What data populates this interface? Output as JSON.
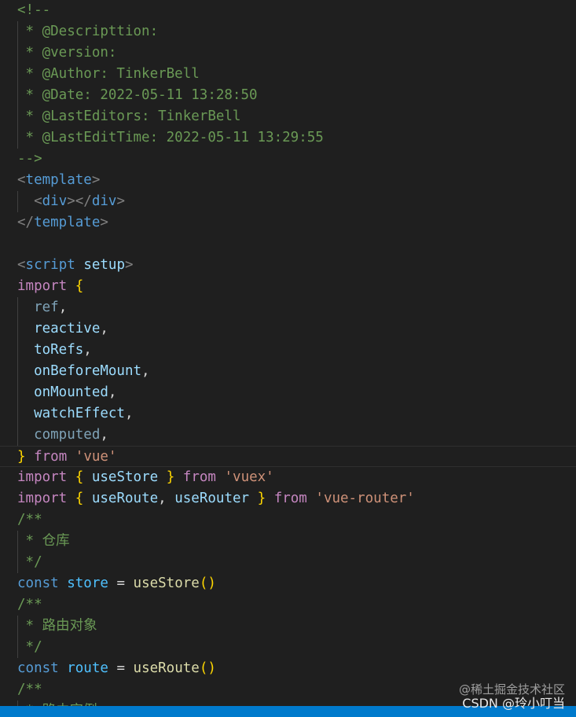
{
  "editor": {
    "lines": [
      {
        "indent": 0,
        "tokens": [
          [
            "c-comment",
            "<!--"
          ]
        ]
      },
      {
        "indent": 0,
        "guide": true,
        "tokens": [
          [
            "c-comment",
            " * @Descripttion:"
          ]
        ]
      },
      {
        "indent": 0,
        "guide": true,
        "tokens": [
          [
            "c-comment",
            " * @version:"
          ]
        ]
      },
      {
        "indent": 0,
        "guide": true,
        "tokens": [
          [
            "c-comment",
            " * @Author: TinkerBell"
          ]
        ]
      },
      {
        "indent": 0,
        "guide": true,
        "tokens": [
          [
            "c-comment",
            " * @Date: 2022-05-11 13:28:50"
          ]
        ]
      },
      {
        "indent": 0,
        "guide": true,
        "tokens": [
          [
            "c-comment",
            " * @LastEditors: TinkerBell"
          ]
        ]
      },
      {
        "indent": 0,
        "guide": true,
        "tokens": [
          [
            "c-comment",
            " * @LastEditTime: 2022-05-11 13:29:55"
          ]
        ]
      },
      {
        "indent": 0,
        "tokens": [
          [
            "c-comment",
            "-->"
          ]
        ]
      },
      {
        "indent": 0,
        "tokens": [
          [
            "c-tag-punct",
            "<"
          ],
          [
            "c-tag",
            "template"
          ],
          [
            "c-tag-punct",
            ">"
          ]
        ]
      },
      {
        "indent": 0,
        "guide": true,
        "tokens": [
          [
            "c-plain",
            "  "
          ],
          [
            "c-tag-punct",
            "<"
          ],
          [
            "c-tag",
            "div"
          ],
          [
            "c-tag-punct",
            "></"
          ],
          [
            "c-tag",
            "div"
          ],
          [
            "c-tag-punct",
            ">"
          ]
        ]
      },
      {
        "indent": 0,
        "tokens": [
          [
            "c-tag-punct",
            "</"
          ],
          [
            "c-tag",
            "template"
          ],
          [
            "c-tag-punct",
            ">"
          ]
        ]
      },
      {
        "indent": 0,
        "tokens": [
          [
            "c-plain",
            ""
          ]
        ]
      },
      {
        "indent": 0,
        "tokens": [
          [
            "c-tag-punct",
            "<"
          ],
          [
            "c-tag",
            "script"
          ],
          [
            "c-plain",
            " "
          ],
          [
            "c-attr",
            "setup"
          ],
          [
            "c-tag-punct",
            ">"
          ]
        ]
      },
      {
        "indent": 0,
        "tokens": [
          [
            "c-keyword",
            "import"
          ],
          [
            "c-plain",
            " "
          ],
          [
            "c-brace",
            "{"
          ]
        ]
      },
      {
        "indent": 0,
        "guide": true,
        "tokens": [
          [
            "c-plain",
            "  "
          ],
          [
            "c-var-faint",
            "ref"
          ],
          [
            "c-plain",
            ","
          ]
        ]
      },
      {
        "indent": 0,
        "guide": true,
        "tokens": [
          [
            "c-plain",
            "  "
          ],
          [
            "c-var",
            "reactive"
          ],
          [
            "c-plain",
            ","
          ]
        ]
      },
      {
        "indent": 0,
        "guide": true,
        "tokens": [
          [
            "c-plain",
            "  "
          ],
          [
            "c-var",
            "toRefs"
          ],
          [
            "c-plain",
            ","
          ]
        ]
      },
      {
        "indent": 0,
        "guide": true,
        "tokens": [
          [
            "c-plain",
            "  "
          ],
          [
            "c-var",
            "onBeforeMount"
          ],
          [
            "c-plain",
            ","
          ]
        ]
      },
      {
        "indent": 0,
        "guide": true,
        "tokens": [
          [
            "c-plain",
            "  "
          ],
          [
            "c-var",
            "onMounted"
          ],
          [
            "c-plain",
            ","
          ]
        ]
      },
      {
        "indent": 0,
        "guide": true,
        "tokens": [
          [
            "c-plain",
            "  "
          ],
          [
            "c-var",
            "watchEffect"
          ],
          [
            "c-plain",
            ","
          ]
        ]
      },
      {
        "indent": 0,
        "guide": true,
        "tokens": [
          [
            "c-plain",
            "  "
          ],
          [
            "c-var-faint",
            "computed"
          ],
          [
            "c-plain",
            ","
          ]
        ]
      },
      {
        "indent": 0,
        "current": true,
        "tokens": [
          [
            "c-brace",
            "}"
          ],
          [
            "c-plain",
            " "
          ],
          [
            "c-keyword",
            "from"
          ],
          [
            "c-plain",
            " "
          ],
          [
            "c-string",
            "'vue'"
          ]
        ]
      },
      {
        "indent": 0,
        "tokens": [
          [
            "c-keyword",
            "import"
          ],
          [
            "c-plain",
            " "
          ],
          [
            "c-brace",
            "{"
          ],
          [
            "c-plain",
            " "
          ],
          [
            "c-var",
            "useStore"
          ],
          [
            "c-plain",
            " "
          ],
          [
            "c-brace",
            "}"
          ],
          [
            "c-plain",
            " "
          ],
          [
            "c-keyword",
            "from"
          ],
          [
            "c-plain",
            " "
          ],
          [
            "c-string",
            "'vuex'"
          ]
        ]
      },
      {
        "indent": 0,
        "tokens": [
          [
            "c-keyword",
            "import"
          ],
          [
            "c-plain",
            " "
          ],
          [
            "c-brace",
            "{"
          ],
          [
            "c-plain",
            " "
          ],
          [
            "c-var",
            "useRoute"
          ],
          [
            "c-plain",
            ", "
          ],
          [
            "c-var",
            "useRouter"
          ],
          [
            "c-plain",
            " "
          ],
          [
            "c-brace",
            "}"
          ],
          [
            "c-plain",
            " "
          ],
          [
            "c-keyword",
            "from"
          ],
          [
            "c-plain",
            " "
          ],
          [
            "c-string",
            "'vue-router'"
          ]
        ]
      },
      {
        "indent": 0,
        "tokens": [
          [
            "c-comment",
            "/**"
          ]
        ]
      },
      {
        "indent": 0,
        "guide": true,
        "tokens": [
          [
            "c-comment",
            " * 仓库"
          ]
        ]
      },
      {
        "indent": 0,
        "guide": true,
        "tokens": [
          [
            "c-comment",
            " */"
          ]
        ]
      },
      {
        "indent": 0,
        "tokens": [
          [
            "c-storage",
            "const"
          ],
          [
            "c-plain",
            " "
          ],
          [
            "c-const",
            "store"
          ],
          [
            "c-plain",
            " = "
          ],
          [
            "c-func",
            "useStore"
          ],
          [
            "c-brace",
            "()"
          ]
        ]
      },
      {
        "indent": 0,
        "tokens": [
          [
            "c-comment",
            "/**"
          ]
        ]
      },
      {
        "indent": 0,
        "guide": true,
        "tokens": [
          [
            "c-comment",
            " * 路由对象"
          ]
        ]
      },
      {
        "indent": 0,
        "guide": true,
        "tokens": [
          [
            "c-comment",
            " */"
          ]
        ]
      },
      {
        "indent": 0,
        "tokens": [
          [
            "c-storage",
            "const"
          ],
          [
            "c-plain",
            " "
          ],
          [
            "c-const",
            "route"
          ],
          [
            "c-plain",
            " = "
          ],
          [
            "c-func",
            "useRoute"
          ],
          [
            "c-brace",
            "()"
          ]
        ]
      },
      {
        "indent": 0,
        "tokens": [
          [
            "c-comment",
            "/**"
          ]
        ]
      },
      {
        "indent": 0,
        "guide": true,
        "tokens": [
          [
            "c-comment",
            " * 路由实例"
          ]
        ]
      }
    ]
  },
  "watermark": {
    "line1": "@稀土掘金技术社区",
    "line2": "CSDN @玲小叮当"
  },
  "colors": {
    "background": "#1f1f1f",
    "statusbar": "#007acc"
  }
}
